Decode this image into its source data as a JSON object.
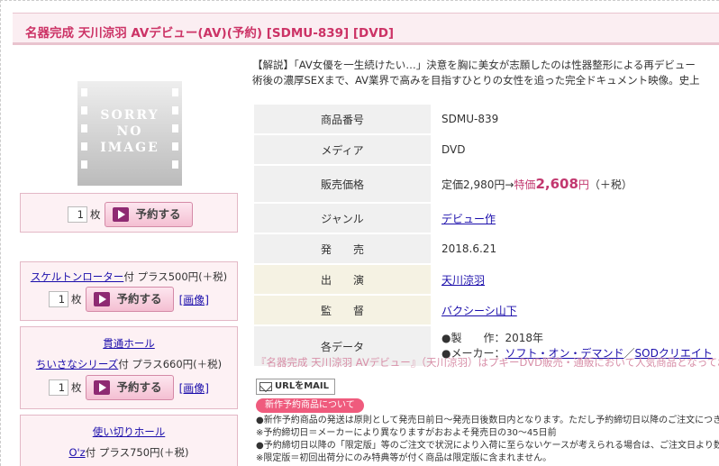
{
  "title": "名器完成 天川涼羽 AVデビュー(AV)(予約) [SDMU-839] [DVD]",
  "noimage": {
    "line1": "SORRY",
    "line2": "NO",
    "line3": "IMAGE"
  },
  "order": {
    "qty": "1",
    "unit": "枚",
    "button": "予約する"
  },
  "options": [
    {
      "link": "スケルトンローター",
      "text": "付 プラス500円(＋税)",
      "qty": "1",
      "unit": "枚",
      "button": "予約する",
      "gazou": "[画像]"
    },
    {
      "link_top": "貫通ホール",
      "link": "ちいさなシリーズ",
      "text": "付 プラス660円(＋税)",
      "qty": "1",
      "unit": "枚",
      "button": "予約する",
      "gazou": "[画像]"
    },
    {
      "link_top": "使い切りホール",
      "link": "O'z",
      "text": "付 プラス750円(＋税)"
    }
  ],
  "description": {
    "line1": "【解説】「AV女優を一生続けたい…」決意を胸に美女が志願したのは性器整形による再デビュー",
    "line2": "術後の濃厚SEXまで、AV業界で高みを目指すひとりの女性を追った完全ドキュメント映像。史上"
  },
  "spec": {
    "product_no_label": "商品番号",
    "product_no": "SDMU-839",
    "media_label": "メディア",
    "media": "DVD",
    "price_label": "販売価格",
    "list_price": "定価2,980円→",
    "sale_prefix": "特価",
    "sale_price": "2,608",
    "yen": "円",
    "tax": "（＋税）",
    "genre_label": "ジャンル",
    "genre": "デビュー作",
    "release_label": "発　　売",
    "release": "2018.6.21",
    "actress_label": "出　　演",
    "actress": "天川涼羽",
    "director_label": "監　　督",
    "director": "バクシーシ山下",
    "data_label": "各データ",
    "year_label": "●製　　作：",
    "year": "2018年",
    "maker_label": "●メーカー：",
    "maker": "ソフト・オン・デマンド",
    "maker_sep": "／",
    "maker2": "SODクリエイト"
  },
  "note1": "『名器完成 天川涼羽 AVデビュー』（天川涼羽）はプギーDVD販売・通販において人気商品となっており",
  "urlmail": "URLをMAIL",
  "new_badge": "新作予約商品について",
  "notes": [
    "●新作予約商品の発送は原則として発売日前日〜発売日後数日内となります。ただし予約締切日以降のご注文につき",
    "※予約締切日＝メーカーにより異なりますがおおよそ発売日の30〜45日前",
    "●予約締切日以降の「限定版」等のご注文で状況により入荷に至らないケースが考えられる場合は、ご注文日より数",
    "※限定版＝初回出荷分にのみ特典等が付く商品は限定版に含まれません。"
  ]
}
